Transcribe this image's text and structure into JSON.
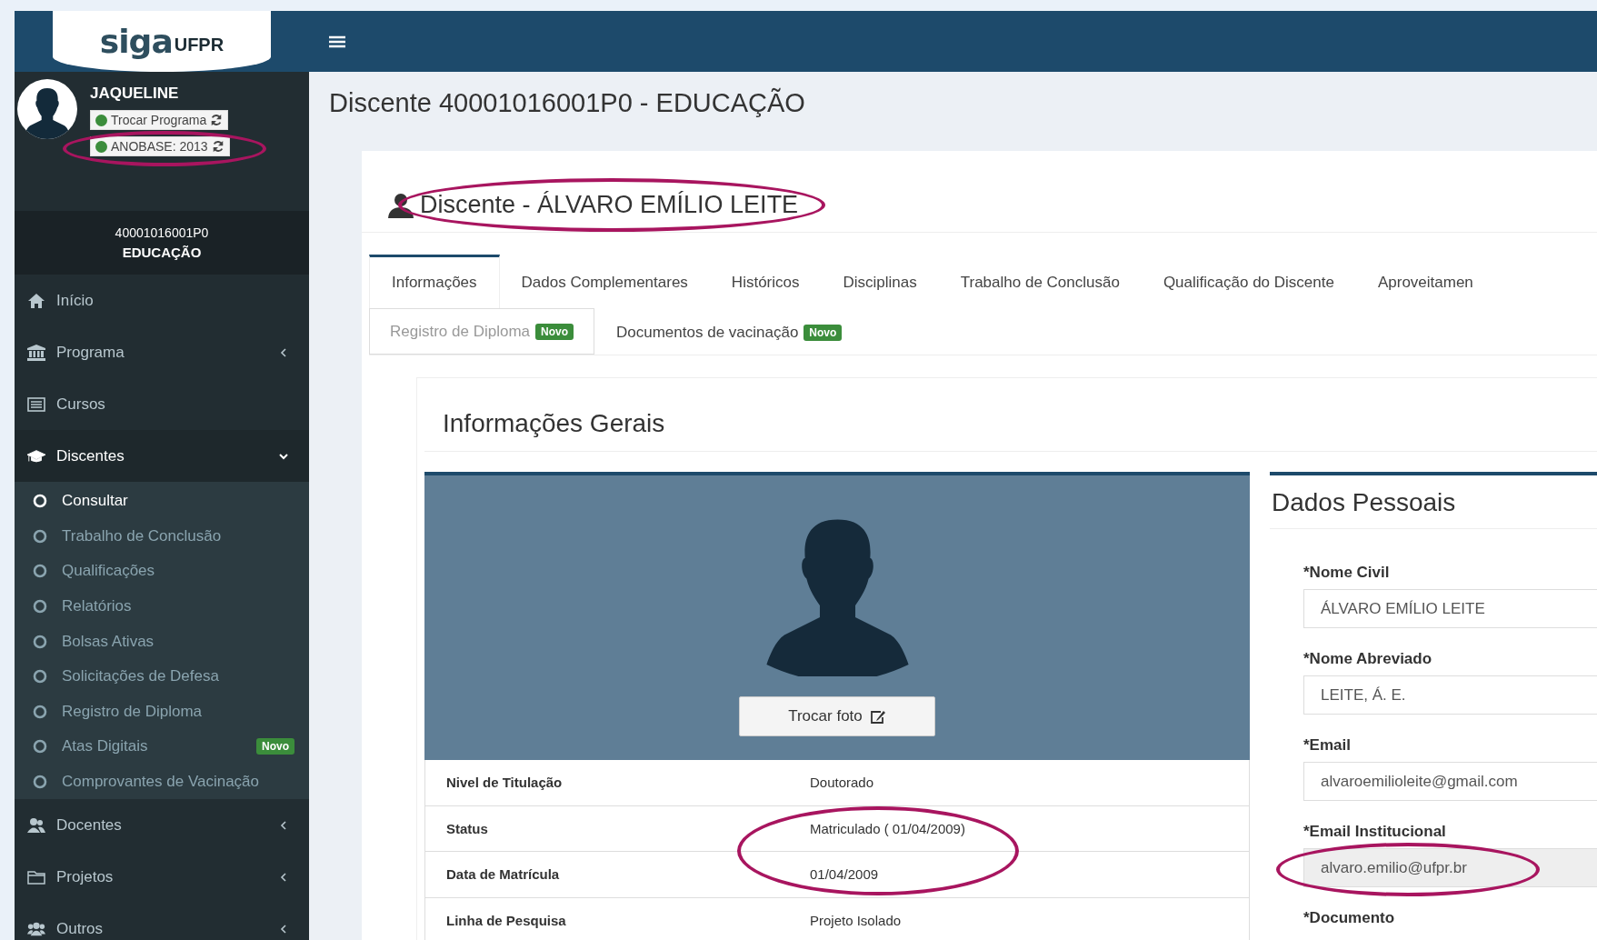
{
  "header": {
    "logo": {
      "brand": "siga",
      "suffix": "UFPR"
    }
  },
  "user": {
    "name": "JAQUELINE",
    "buttons": [
      {
        "label": "Trocar Programa",
        "color": "#3c8d3c"
      },
      {
        "label": "ANOBASE: 2013",
        "color": "#3c8d3c"
      }
    ]
  },
  "program": {
    "code": "40001016001P0",
    "name": "EDUCAÇÃO"
  },
  "sidebar": {
    "items": [
      {
        "label": "Início",
        "selected": false
      },
      {
        "label": "Programa",
        "selected": false,
        "expanded": false
      },
      {
        "label": "Cursos",
        "selected": false
      },
      {
        "label": "Discentes",
        "selected": true,
        "expanded": true,
        "children": [
          {
            "label": "Consultar",
            "selected": true
          },
          {
            "label": "Trabalho de Conclusão",
            "selected": false
          },
          {
            "label": "Qualificações",
            "selected": false
          },
          {
            "label": "Relatórios",
            "selected": false
          },
          {
            "label": "Bolsas Ativas",
            "selected": false
          },
          {
            "label": "Solicitações de Defesa",
            "selected": false
          },
          {
            "label": "Registro de Diploma",
            "selected": false
          },
          {
            "label": "Atas Digitais",
            "selected": false,
            "badge": "Novo"
          },
          {
            "label": "Comprovantes de Vacinação",
            "selected": false
          }
        ]
      },
      {
        "label": "Docentes",
        "selected": false,
        "expanded": false
      },
      {
        "label": "Projetos",
        "selected": false,
        "expanded": false
      },
      {
        "label": "Outros",
        "selected": false,
        "expanded": false
      }
    ]
  },
  "page_title": "Discente 40001016001P0 - EDUCAÇÃO",
  "card": {
    "title": "Discente - ÁLVARO EMÍLIO LEITE",
    "tabs": [
      {
        "label": "Informações",
        "selected": true,
        "disabled": false
      },
      {
        "label": "Dados Complementares",
        "selected": false,
        "disabled": false
      },
      {
        "label": "Históricos",
        "selected": false,
        "disabled": false
      },
      {
        "label": "Disciplinas",
        "selected": false,
        "disabled": false
      },
      {
        "label": "Trabalho de Conclusão",
        "selected": false,
        "disabled": false
      },
      {
        "label": "Qualificação do Discente",
        "selected": false,
        "disabled": false
      },
      {
        "label": "Aproveitamen",
        "selected": false,
        "disabled": false
      },
      {
        "label": "Registro de Diploma",
        "selected": false,
        "disabled": true,
        "badge": "Novo"
      },
      {
        "label": "Documentos de vacinação",
        "selected": false,
        "disabled": false,
        "badge": "Novo"
      }
    ],
    "section_title": "Informações Gerais",
    "photo": {
      "button": "Trocar foto"
    },
    "info_rows": [
      {
        "label": "Nivel de Titulação",
        "value": "Doutorado"
      },
      {
        "label": "Status",
        "value": "Matriculado ( 01/04/2009)"
      },
      {
        "label": "Data de Matrícula",
        "value": "01/04/2009"
      },
      {
        "label": "Linha de Pesquisa",
        "value": "Projeto Isolado"
      }
    ],
    "personal": {
      "title": "Dados Pessoais",
      "fields": [
        {
          "label": "*Nome Civil",
          "value": "ÁLVARO EMÍLIO LEITE",
          "readonly": false
        },
        {
          "label": "*Nome Abreviado",
          "value": "LEITE, Á. E.",
          "readonly": false
        },
        {
          "label": "*Email",
          "value": "alvaroemilioleite@gmail.com",
          "readonly": false
        },
        {
          "label": "*Email Institucional",
          "value": "alvaro.emilio@ufpr.br",
          "readonly": true
        },
        {
          "label": "*Documento"
        }
      ]
    }
  }
}
